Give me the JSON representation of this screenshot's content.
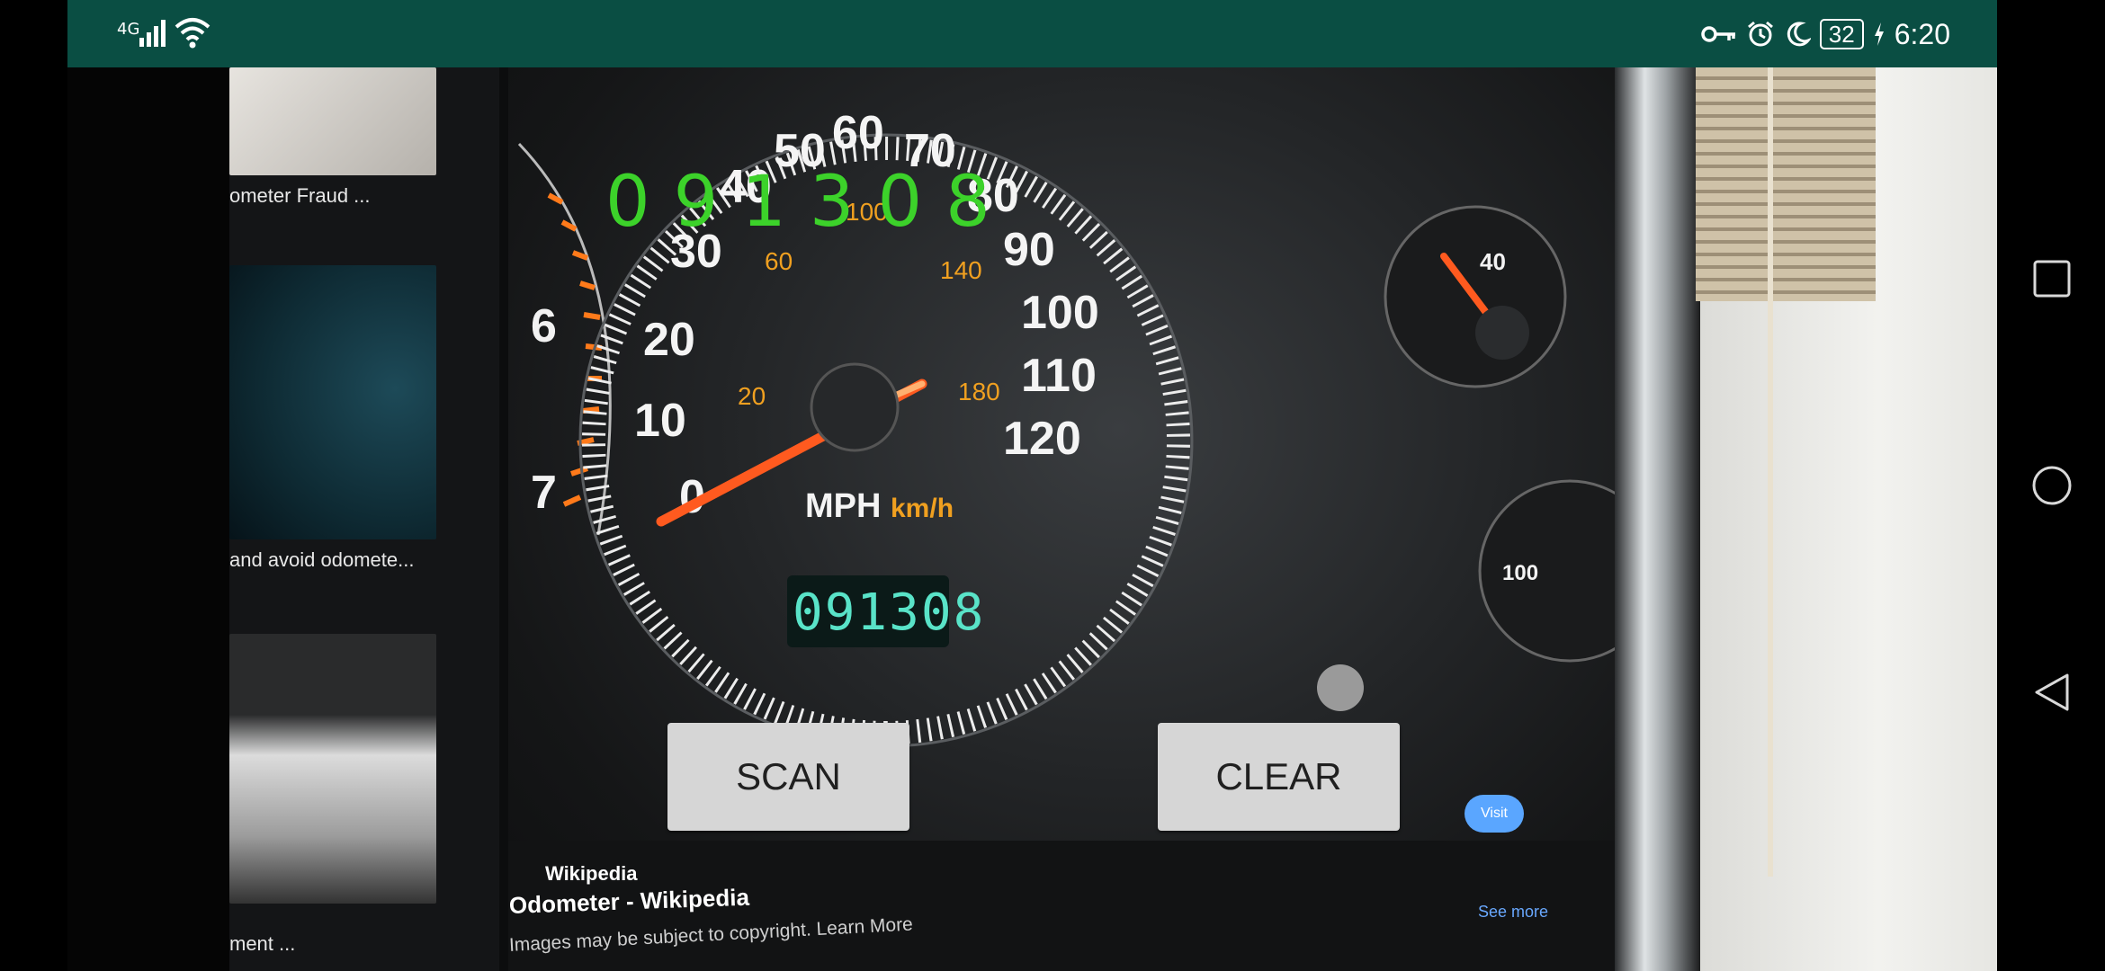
{
  "status_bar": {
    "network": "4G",
    "battery": "32",
    "time": "6:20",
    "icons": [
      "signal-icon",
      "wifi-icon",
      "vpn-key-icon",
      "alarm-icon",
      "do-not-disturb-icon",
      "battery-icon",
      "charging-icon"
    ]
  },
  "overlay": {
    "reading": "091308"
  },
  "buttons": {
    "scan": "SCAN",
    "clear": "CLEAR"
  },
  "camera_preview": {
    "thumbnail_captions": [
      "ometer Fraud ...",
      "and avoid odomete...",
      "ment ..."
    ],
    "source": "Wikipedia",
    "title": "Odometer - Wikipedia",
    "copyright": "Images may be subject to copyright. Learn More",
    "visit": "Visit",
    "see_more": "See more",
    "speedo": {
      "mph_labels": [
        "0",
        "10",
        "20",
        "30",
        "40",
        "50",
        "60",
        "70",
        "80",
        "90",
        "100",
        "110",
        "120"
      ],
      "kmh_labels": [
        "20",
        "60",
        "100",
        "140",
        "180"
      ],
      "unit_mph": "MPH",
      "unit_kmh": "km/h",
      "odometer": "091308",
      "tach_labels": [
        "6",
        "7"
      ],
      "oil_gauge_label": "40",
      "temp_gauge_label": "100"
    }
  },
  "nav_bar": {
    "buttons": [
      "recents",
      "home",
      "back"
    ]
  },
  "colors": {
    "status_bar": "#0a4e43",
    "reading": "#3cd22a",
    "button_bg": "#d6d6d6",
    "needle": "#ff5a1f"
  }
}
